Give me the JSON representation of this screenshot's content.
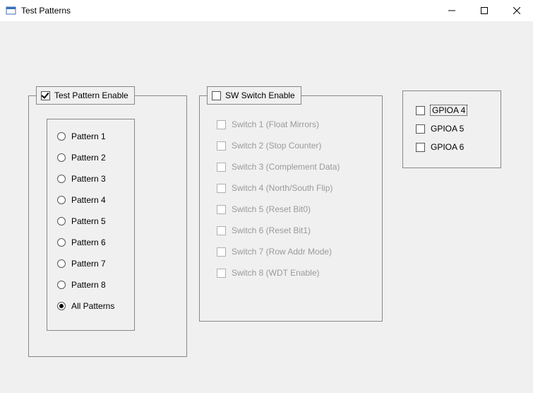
{
  "window": {
    "title": "Test Patterns"
  },
  "test_pattern": {
    "enable_label": "Test Pattern Enable",
    "enable_checked": true,
    "options": [
      {
        "label": "Pattern 1",
        "selected": false
      },
      {
        "label": "Pattern 2",
        "selected": false
      },
      {
        "label": "Pattern 3",
        "selected": false
      },
      {
        "label": "Pattern 4",
        "selected": false
      },
      {
        "label": "Pattern 5",
        "selected": false
      },
      {
        "label": "Pattern 6",
        "selected": false
      },
      {
        "label": "Pattern 7",
        "selected": false
      },
      {
        "label": "Pattern 8",
        "selected": false
      },
      {
        "label": "All Patterns",
        "selected": true
      }
    ]
  },
  "sw_switch": {
    "enable_label": "SW Switch Enable",
    "enable_checked": false,
    "switches": [
      {
        "label": "Switch 1 (Float Mirrors)"
      },
      {
        "label": "Switch 2 (Stop Counter)"
      },
      {
        "label": "Switch 3 (Complement Data)"
      },
      {
        "label": "Switch 4 (North/South Flip)"
      },
      {
        "label": "Switch 5 (Reset Bit0)"
      },
      {
        "label": "Switch 6 (Reset Bit1)"
      },
      {
        "label": "Switch 7 (Row Addr Mode)"
      },
      {
        "label": "Switch 8 (WDT Enable)"
      }
    ]
  },
  "gpio": {
    "items": [
      {
        "label": "GPIOA 4",
        "focused": true
      },
      {
        "label": "GPIOA 5",
        "focused": false
      },
      {
        "label": "GPIOA 6",
        "focused": false
      }
    ]
  }
}
